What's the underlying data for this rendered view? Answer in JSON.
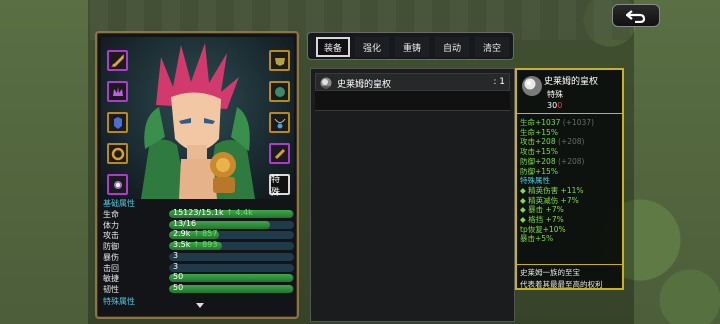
{
  "tabs": [
    {
      "label": "装备",
      "active": true
    },
    {
      "label": "强化",
      "active": false
    },
    {
      "label": "重铸",
      "active": false
    },
    {
      "label": "自动",
      "active": false
    },
    {
      "label": "清空",
      "active": false
    }
  ],
  "character": {
    "special_slot_label": "特殊",
    "base_attr_title": "基础属性",
    "special_attr_title": "特殊属性",
    "stats": [
      {
        "label": "生命",
        "value": "15123/15.1k",
        "bonus": "↑ 4.4k",
        "fill": 0.99
      },
      {
        "label": "体力",
        "value": "13/16",
        "bonus": "",
        "fill": 0.81
      },
      {
        "label": "攻击",
        "value": "2.9k",
        "bonus": "↑ 857",
        "fill": 0.4
      },
      {
        "label": "防御",
        "value": "3.5k",
        "bonus": "↑ 893",
        "fill": 0.42
      },
      {
        "label": "暴伤",
        "value": "3",
        "bonus": "",
        "fill": 0
      },
      {
        "label": "击回",
        "value": "3",
        "bonus": "",
        "fill": 0
      },
      {
        "label": "敏捷",
        "value": "50",
        "bonus": "",
        "fill": 0.99
      },
      {
        "label": "韧性",
        "value": "50",
        "bonus": "",
        "fill": 0.99
      }
    ]
  },
  "item_list": [
    {
      "name": "史莱姆的皇权",
      "count": ": 1"
    }
  ],
  "detail": {
    "title": "史莱姆的皇权",
    "type": "特殊",
    "price_num": "30",
    "price_unit": "0",
    "attrs": [
      {
        "text": "生命+1037",
        "extra": "(+1037)"
      },
      {
        "text": "生命+15%",
        "extra": ""
      },
      {
        "text": "攻击+208",
        "extra": "(+208)"
      },
      {
        "text": "攻击+15%",
        "extra": ""
      },
      {
        "text": "防御+208",
        "extra": "(+208)"
      },
      {
        "text": "防御+15%",
        "extra": ""
      }
    ],
    "special_title": "特殊属性",
    "special_attrs": [
      "精英伤害 +11%",
      "精英减伤 +7%",
      "暴击 +7%",
      "格挡 +7%"
    ],
    "extra_attrs": [
      "tp恢复+10%",
      "暴击+5%"
    ],
    "description": [
      "史莱姆一族的至宝",
      "代表着其最最至高的权利"
    ]
  },
  "colors": {
    "gold_border": "#8c7540",
    "purple_slot": "#b03ad0",
    "gold_slot": "#b88a1c",
    "detail_border": "#c9b21e",
    "stat_bar": "#3ea84a",
    "cyan_text": "#4ec9e0"
  }
}
